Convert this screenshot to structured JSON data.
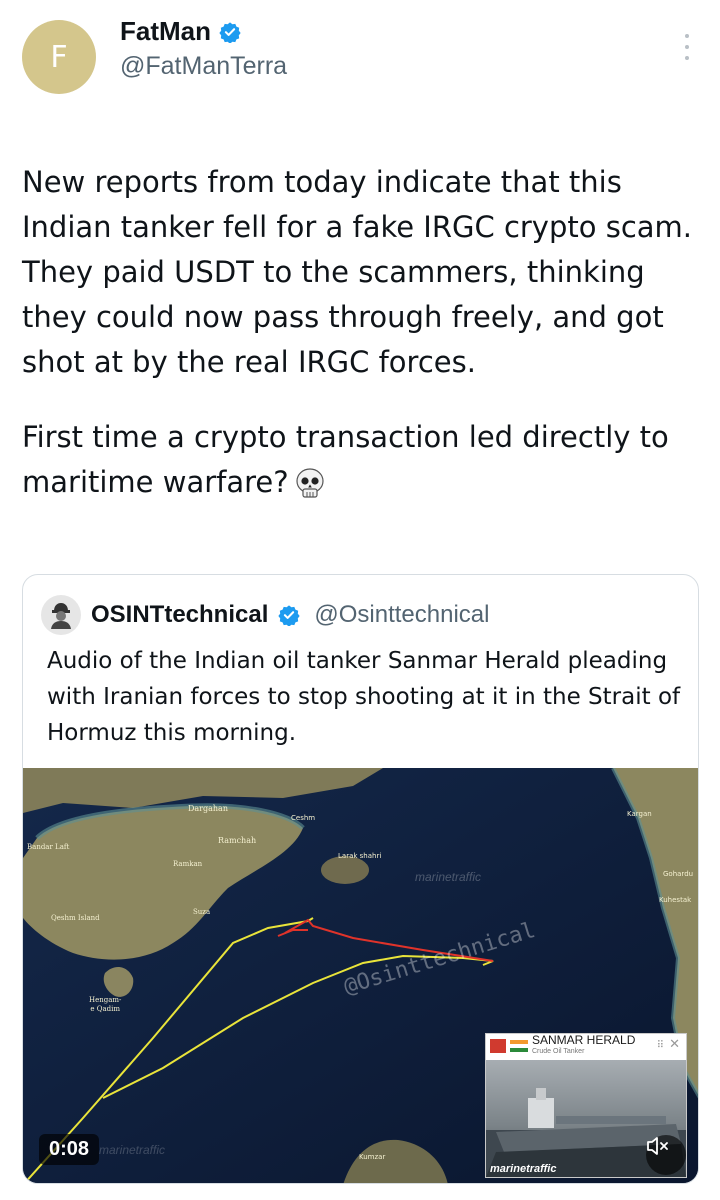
{
  "author": {
    "avatar_letter": "F",
    "name": "FatMan",
    "handle": "@FatManTerra"
  },
  "tweet": {
    "paragraph1": "New reports from today indicate that this Indian tanker fell for a fake IRGC crypto scam. They paid USDT to the scammers, thinking they could now pass through freely, and got shot at by the real IRGC forces.",
    "paragraph2": "First time a crypto transaction led directly to maritime warfare?",
    "emoji_icon": "skull-icon"
  },
  "quoted_tweet": {
    "name": "OSINTtechnical",
    "handle": "@Osinttechnical",
    "text": "Audio of the Indian oil tanker Sanmar Herald pleading with Iranian forces to stop shooting at it in the Strait of Hormuz this morning."
  },
  "media": {
    "timestamp": "0:08",
    "watermark": "@Osinttechnical",
    "mt_watermark": "marinetraffic",
    "map_labels": {
      "dargahan": "Dargahan",
      "ceshm": "Ceshm",
      "ramchah": "Ramchah",
      "bandar_laft": "Bandar Laft",
      "ramkan": "Ramkan",
      "larak": "Larak shahri",
      "suza": "Suza",
      "qeshm_island": "Qeshm Island",
      "hengam": "Hengam-\ne Qadim",
      "kargan": "Kargan",
      "gohardu": "Gohardu",
      "kuhestak": "Kuhestak",
      "kumzar": "Kumzar"
    },
    "vessel": {
      "name": "SANMAR HERALD",
      "type": "Crude Oil Tanker",
      "watermark": "marinetraffic"
    },
    "colors": {
      "track_yellow": "#e9e43a",
      "track_red": "#e0332a",
      "sea": "#0d1c3a",
      "land": "#8a8660"
    }
  }
}
